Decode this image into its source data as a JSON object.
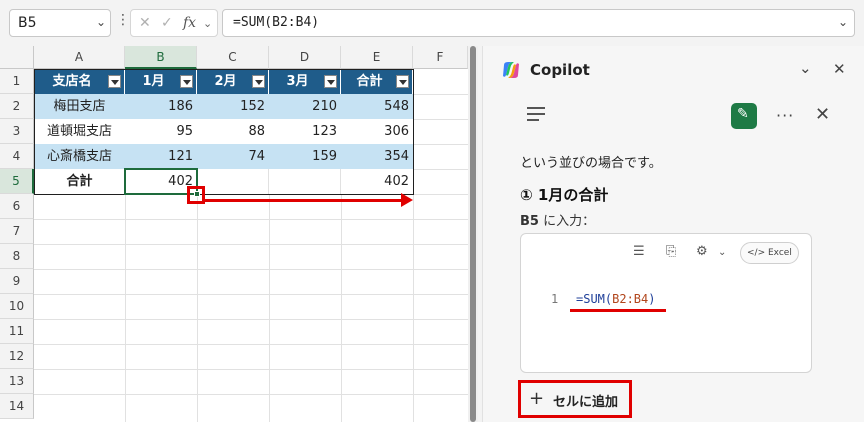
{
  "formula_bar": {
    "name_box": "B5",
    "formula": "=SUM(B2:B4)"
  },
  "grid": {
    "columns": [
      "A",
      "B",
      "C",
      "D",
      "E",
      "F"
    ],
    "rows": [
      "1",
      "2",
      "3",
      "4",
      "5",
      "6",
      "7",
      "8",
      "9",
      "10",
      "11",
      "12",
      "13",
      "14"
    ],
    "headers": [
      "支店名",
      "1月",
      "2月",
      "3月",
      "合計"
    ],
    "data": [
      [
        "梅田支店",
        "186",
        "152",
        "210",
        "548"
      ],
      [
        "道頓堀支店",
        "95",
        "88",
        "123",
        "306"
      ],
      [
        "心斎橋支店",
        "121",
        "74",
        "159",
        "354"
      ],
      [
        "合計",
        "402",
        "",
        "",
        "402"
      ]
    ]
  },
  "copilot": {
    "title": "Copilot",
    "message": "という並びの場合です。",
    "step_title": "① 1月の合計",
    "cell_ref": "B5",
    "input_instruction": " に入力：",
    "code_badge": "Excel",
    "code_line_number": "1",
    "code_prefix": "=SUM(",
    "code_arg": "B2:B4",
    "code_suffix": ")",
    "add_button": "セルに追加"
  },
  "colors": {
    "table_header": "#1f5c8a",
    "band_row": "#c6e2f3",
    "selection": "#1e6b3c",
    "annotation_red": "#e00000"
  }
}
